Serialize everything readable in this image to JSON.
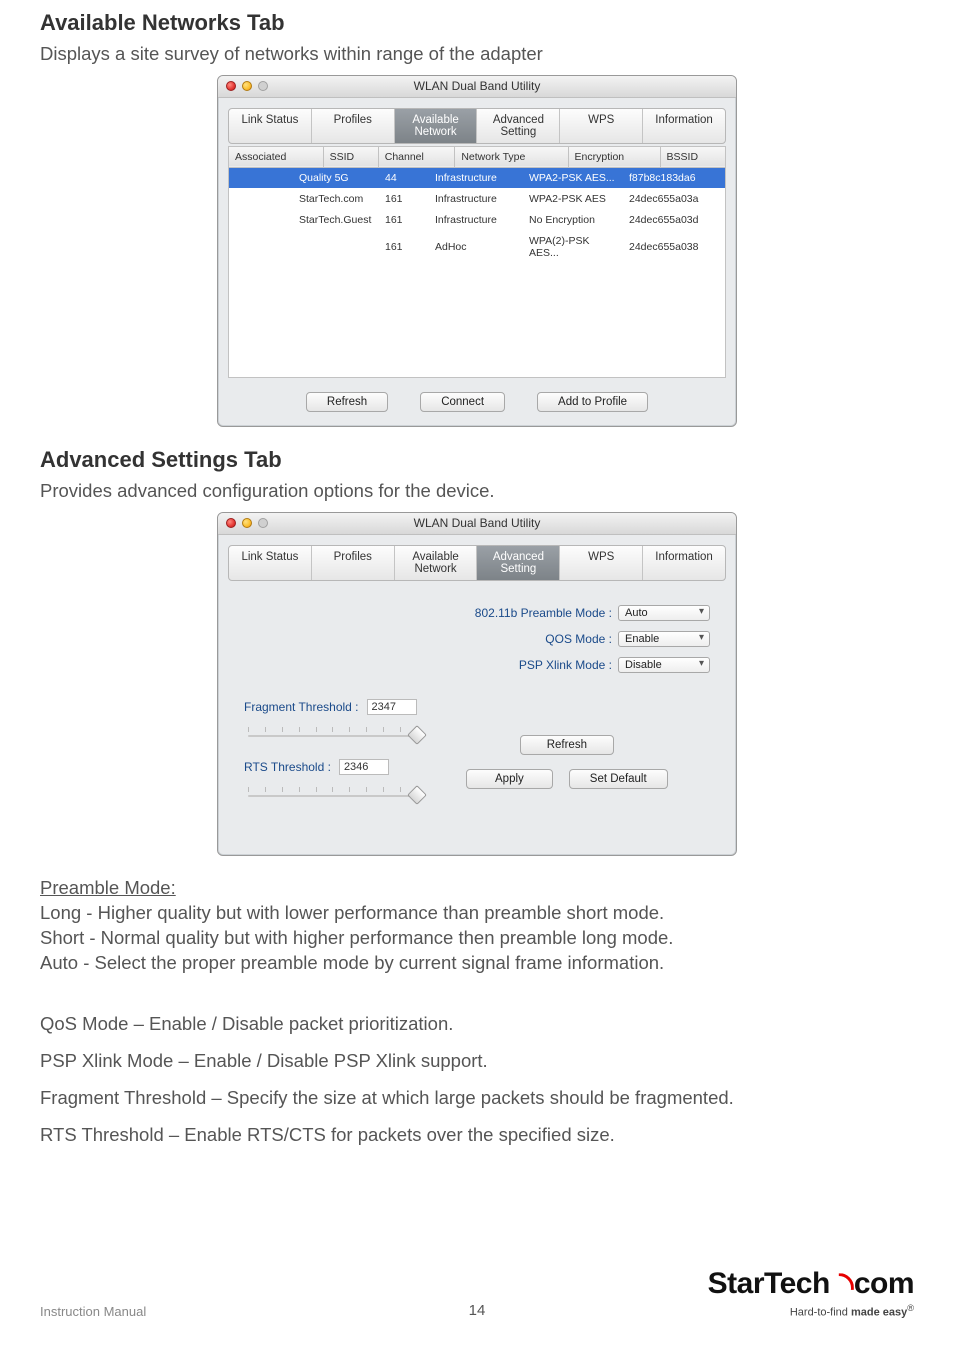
{
  "heading1": "Available Networks Tab",
  "desc1": "Displays a site survey of networks within range of the adapter",
  "heading2": "Advanced Settings Tab",
  "desc2": "Provides advanced configuration options for the device.",
  "win_title": "WLAN Dual Band Utility",
  "tabs": {
    "link_status": "Link Status",
    "profiles": "Profiles",
    "available_network": "Available Network",
    "advanced_setting": "Advanced Setting",
    "wps": "WPS",
    "information": "Information"
  },
  "an_cols": {
    "associated": "Associated",
    "ssid": "SSID",
    "channel": "Channel",
    "network_type": "Network Type",
    "encryption": "Encryption",
    "bssid": "BSSID"
  },
  "an_rows": [
    {
      "ssid": "Quality 5G",
      "channel": "44",
      "ntype": "Infrastructure",
      "enc": "WPA2-PSK AES...",
      "bssid": "f87b8c183da6"
    },
    {
      "ssid": "StarTech.com",
      "channel": "161",
      "ntype": "Infrastructure",
      "enc": "WPA2-PSK AES",
      "bssid": "24dec655a03a"
    },
    {
      "ssid": "StarTech.Guest",
      "channel": "161",
      "ntype": "Infrastructure",
      "enc": "No Encryption",
      "bssid": "24dec655a03d"
    },
    {
      "ssid": "",
      "channel": "161",
      "ntype": "AdHoc",
      "enc": "WPA(2)-PSK AES...",
      "bssid": "24dec655a038"
    }
  ],
  "btn": {
    "refresh": "Refresh",
    "connect": "Connect",
    "add_profile": "Add to Profile",
    "apply": "Apply",
    "set_default": "Set Default"
  },
  "adv": {
    "preamble_label": "802.11b  Preamble Mode :",
    "preamble_val": "Auto",
    "qos_label": "QOS Mode :",
    "qos_val": "Enable",
    "psp_label": "PSP Xlink Mode :",
    "psp_val": "Disable",
    "frag_label": "Fragment Threshold :",
    "frag_val": "2347",
    "rts_label": "RTS Threshold :",
    "rts_val": "2346"
  },
  "preamble_heading": "Preamble Mode: ",
  "preamble_long": "Long - Higher quality but with lower performance than preamble short mode.",
  "preamble_short": "Short - Normal quality but with higher performance then preamble long mode.",
  "preamble_auto": "Auto - Select the proper preamble mode by current signal frame information.",
  "qos_line": "QoS Mode – Enable / Disable packet prioritization.",
  "psp_line": "PSP Xlink Mode – Enable / Disable PSP Xlink support.",
  "frag_line": "Fragment Threshold – Specify the size at which large packets should be fragmented.",
  "rts_line": "RTS Threshold – Enable RTS/CTS for packets over the specified size.",
  "footer_left": "Instruction Manual",
  "footer_page": "14",
  "logo_tag_pre": "Hard-to-find ",
  "logo_tag_bold": "made easy",
  "logo_brand": "StarTech",
  "logo_suffix": "com"
}
